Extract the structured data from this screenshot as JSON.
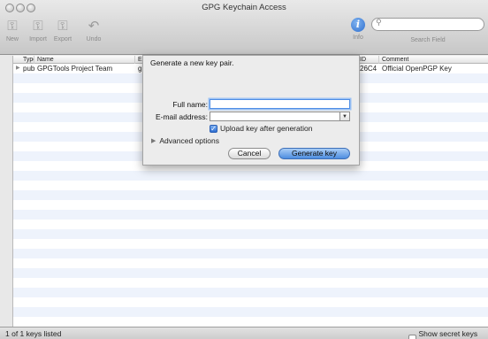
{
  "window": {
    "title": "GPG Keychain Access"
  },
  "toolbar": {
    "items": [
      {
        "label": "New"
      },
      {
        "label": "Import"
      },
      {
        "label": "Export"
      },
      {
        "label": "Undo"
      }
    ],
    "info_label": "Info",
    "search_label": "Search Field",
    "search_value": ""
  },
  "table": {
    "columns": [
      "Type",
      "Name",
      "E-",
      "ID",
      "Comment"
    ],
    "rows": [
      {
        "type": "pub",
        "name": "GPGTools Project Team",
        "email": "gp",
        "id": "26C4",
        "comment": "Official OpenPGP Key"
      }
    ]
  },
  "status": {
    "count": "1 of 1 keys listed",
    "show_secret": "Show secret keys only"
  },
  "sheet": {
    "title": "Generate a new key pair.",
    "full_name_label": "Full name:",
    "full_name_value": "",
    "email_label": "E-mail address:",
    "email_value": "",
    "upload_label": "Upload key after generation",
    "advanced_label": "Advanced options",
    "cancel_label": "Cancel",
    "generate_label": "Generate key"
  }
}
